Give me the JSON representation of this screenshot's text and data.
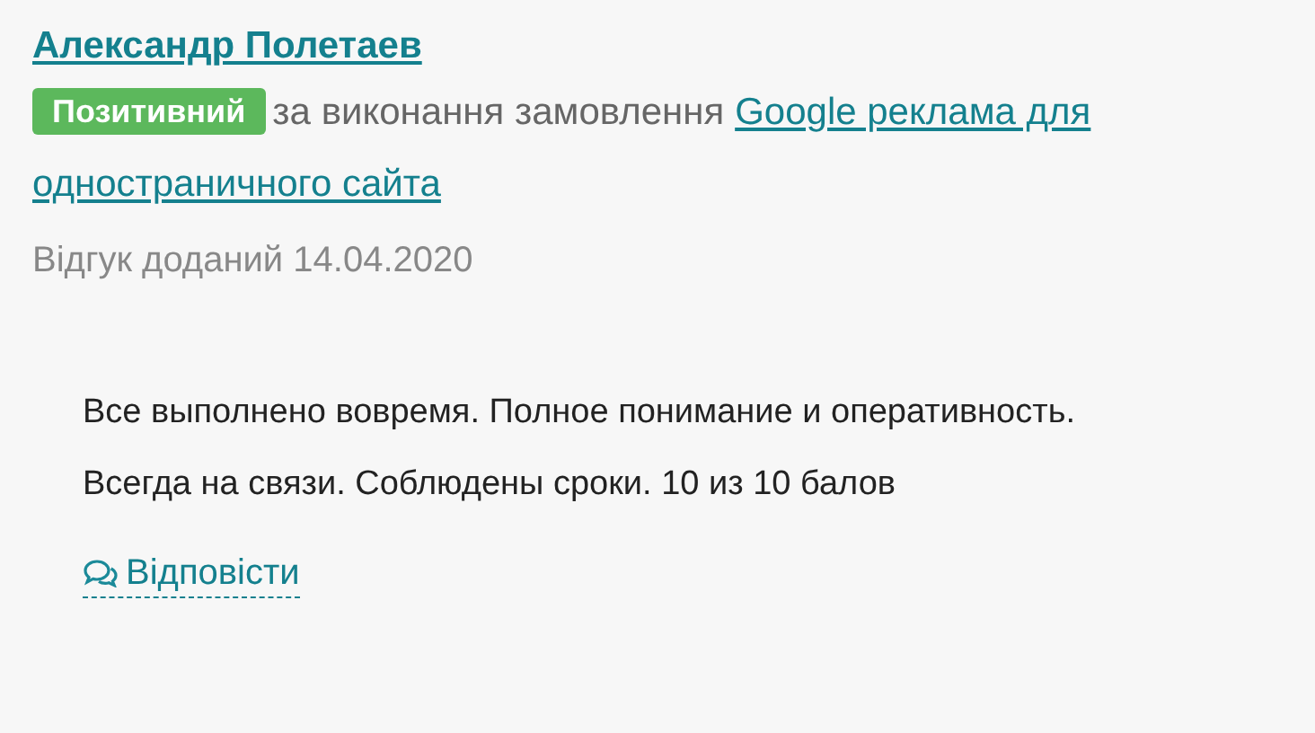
{
  "author": "Александр Полетаев",
  "badge": "Позитивний",
  "order_prefix": "за виконання замовлення",
  "order_link": [
    "Google реклама для",
    "одностраничного сайта"
  ],
  "date": "Відгук доданий 14.04.2020",
  "review": "Все выполнено вовремя. Полное понимание и оперативность. Всегда на связи. Соблюдены сроки. 10 из 10 балов",
  "reply": "Відповісти"
}
